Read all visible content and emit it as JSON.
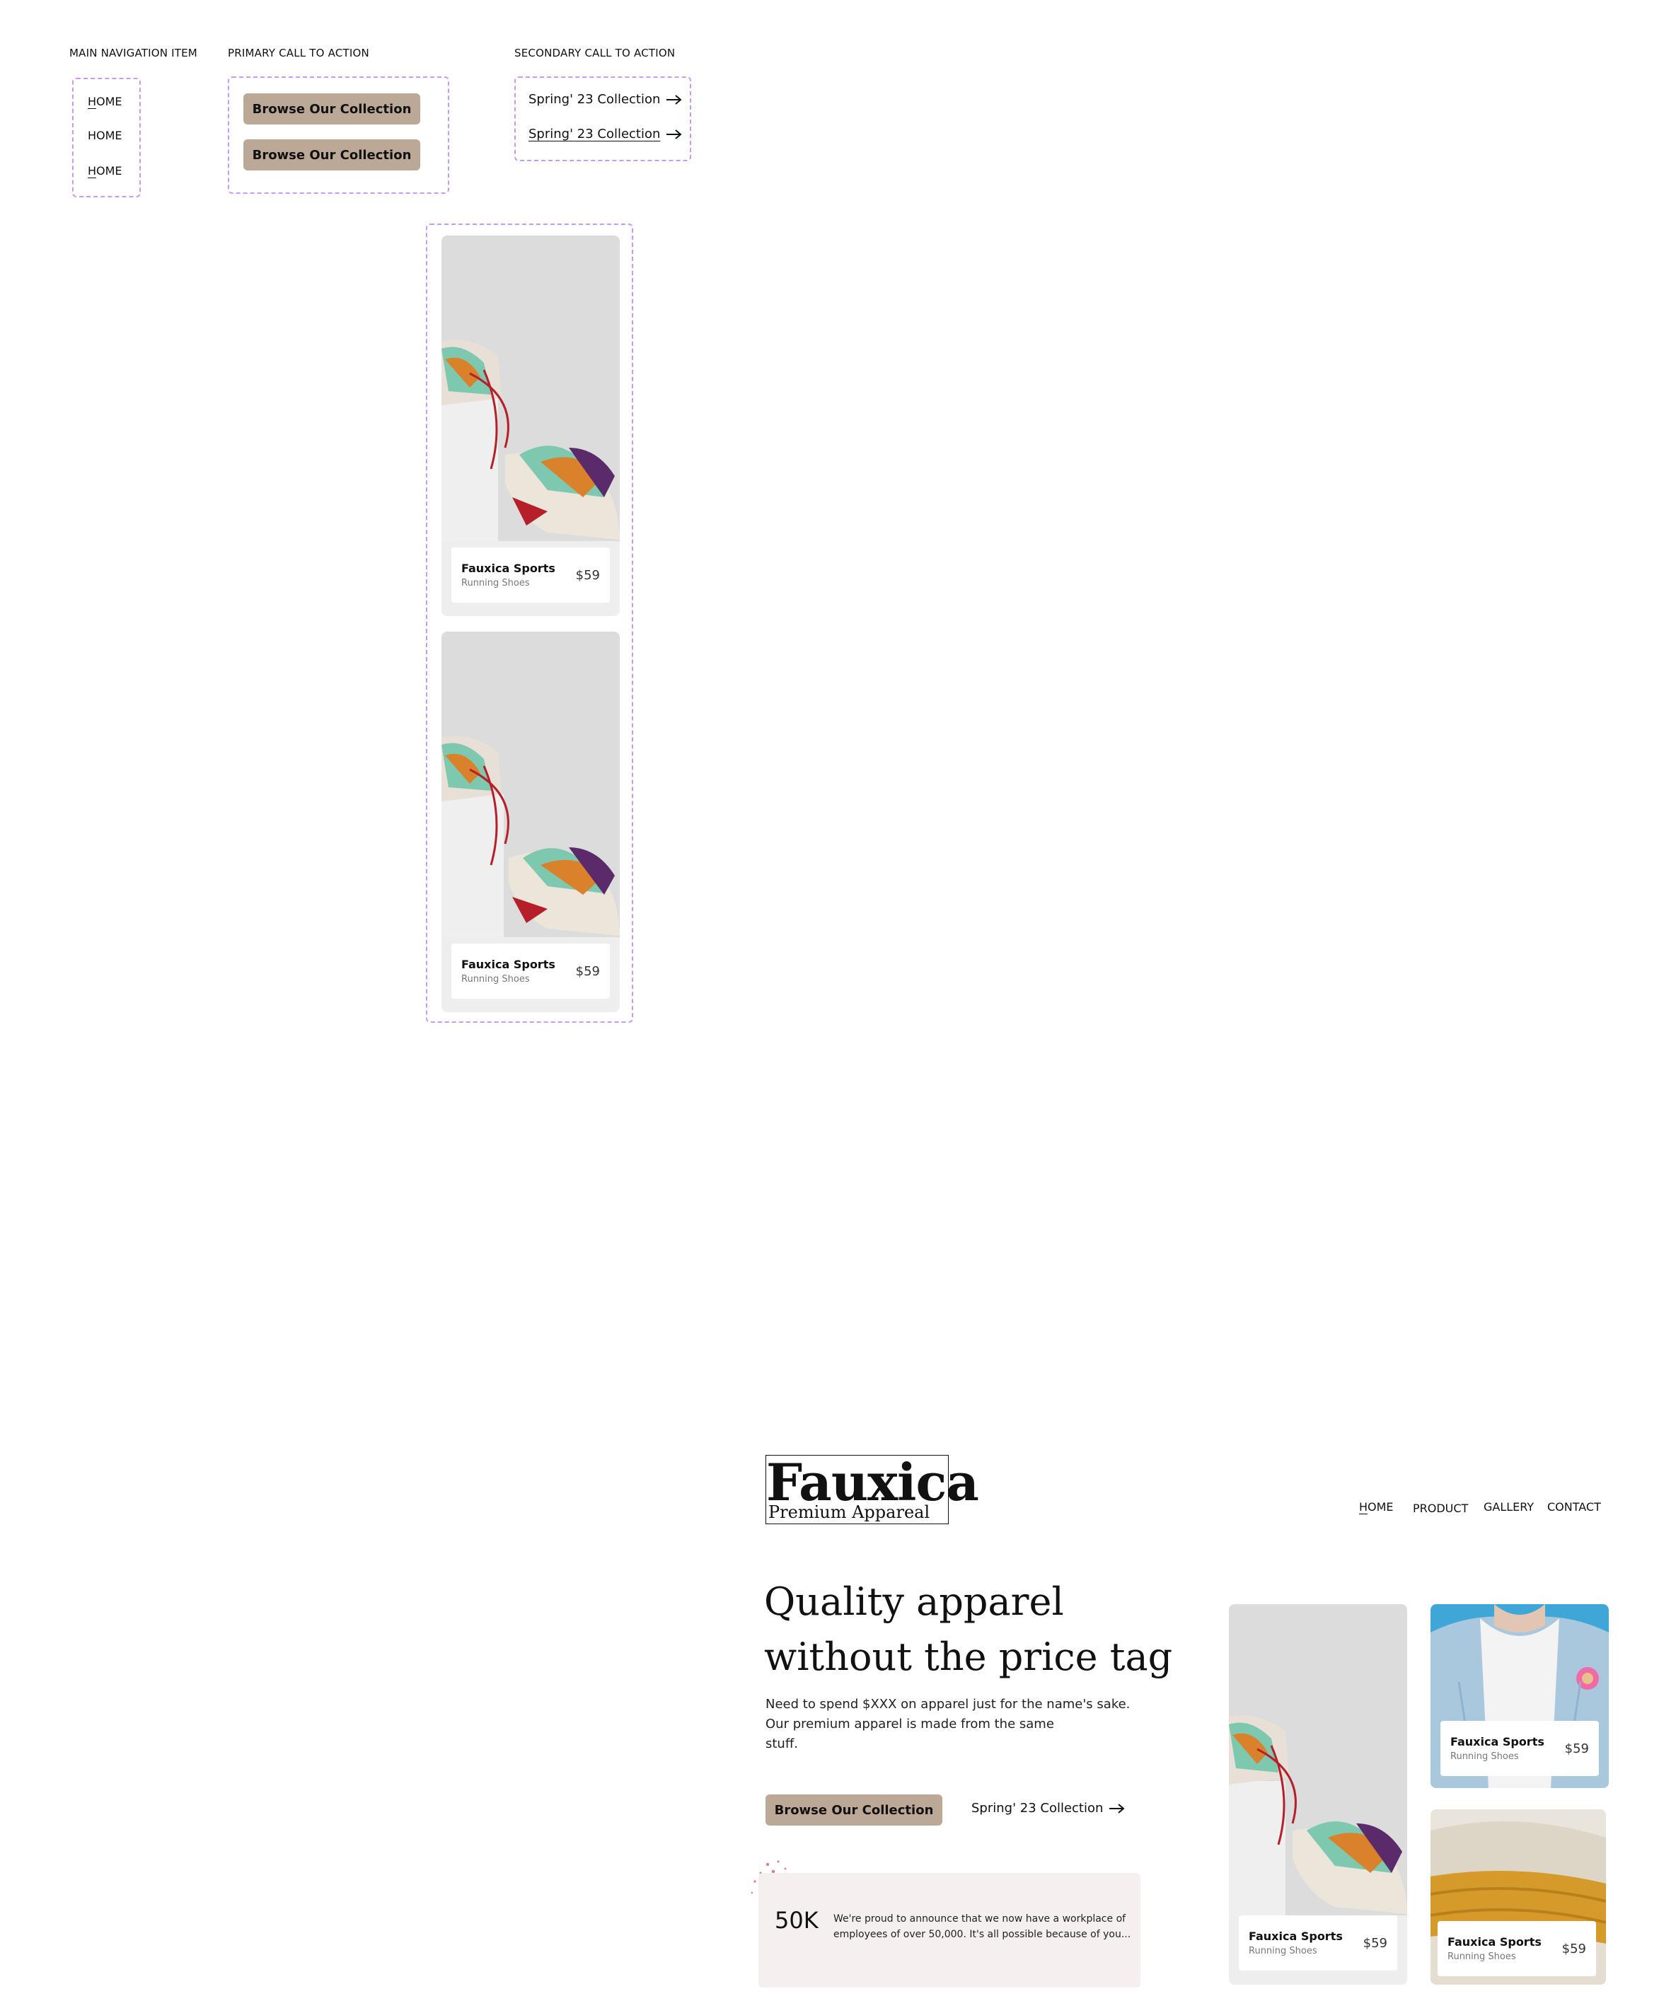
{
  "styleguide": {
    "captions": {
      "main_nav": "MAIN NAVIGATION ITEM",
      "primary_cta": "PRIMARY CALL TO ACTION",
      "secondary_cta": "SECONDARY CALL TO ACTION"
    },
    "nav_states": [
      {
        "first": "H",
        "rest": "OME"
      },
      {
        "first": "H",
        "rest": "OME"
      },
      {
        "first": "H",
        "rest": "OME"
      }
    ],
    "primary_buttons": [
      "Browse Our Collection",
      "Browse Our Collection"
    ],
    "secondary_links": [
      "Spring' 23 Collection",
      "Spring' 23 Collection"
    ],
    "product_cards": [
      {
        "name": "Fauxica Sports",
        "sub": "Running Shoes",
        "price": "$59"
      },
      {
        "name": "Fauxica Sports",
        "sub": "Running Shoes",
        "price": "$59"
      }
    ]
  },
  "site": {
    "logo": {
      "name": "Fauxica",
      "tagline": "Premium Appareal"
    },
    "nav": {
      "home_first": "H",
      "home_rest": "OME",
      "product": "PRODUCT",
      "gallery": "GALLERY",
      "contact": "CONTACT"
    },
    "hero": {
      "title_line1": "Quality apparel",
      "title_line2": "without the price tag",
      "desc_line1": "Need to spend $XXX on apparel just for the name's sake.",
      "desc_line2": "Our premium apparel is made from the same",
      "desc_line3": "stuff.",
      "primary_button": "Browse Our Collection",
      "secondary_link": "Spring' 23 Collection"
    },
    "stat": {
      "value": "50K",
      "text_line1": "We're proud to announce that we now have a workplace of",
      "text_line2": "employees of over 50,000.  It's all possible because of you..."
    },
    "cards": [
      {
        "name": "Fauxica Sports",
        "sub": "Running Shoes",
        "price": "$59"
      },
      {
        "name": "Fauxica Sports",
        "sub": "Running Shoes",
        "price": "$59"
      },
      {
        "name": "Fauxica Sports",
        "sub": "Running Shoes",
        "price": "$59"
      }
    ]
  },
  "icons": {
    "arrow": "arrow-right-icon"
  },
  "colors": {
    "button_bg": "#bca897",
    "dashed_outline": "#c89af2",
    "stat_bg": "#f5efef",
    "card_bg": "#eeeeee"
  }
}
